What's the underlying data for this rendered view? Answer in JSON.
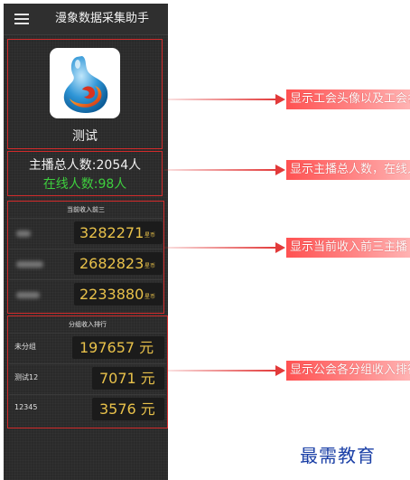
{
  "app": {
    "title": "漫象数据采集助手",
    "union_name": "测试"
  },
  "stats": {
    "total_anchors": "主播总人数:2054人",
    "online_anchors": "在线人数:98人"
  },
  "top_income": {
    "title": "当前收入前三",
    "unit": "星币",
    "rows": [
      {
        "value": "3282271"
      },
      {
        "value": "2682823"
      },
      {
        "value": "2233880"
      }
    ]
  },
  "group_income": {
    "title": "分组收入排行",
    "rows": [
      {
        "name": "未分组",
        "value": "197657 元"
      },
      {
        "name": "测试12",
        "value": "7071 元"
      },
      {
        "name": "12345",
        "value": "3576 元"
      }
    ]
  },
  "callouts": [
    "显示工会头像以及工会名称",
    "显示主播总人数，在线人数",
    "显示当前收入前三主播",
    "显示公会各分组收入排行"
  ],
  "watermark": "最需教育",
  "colors": {
    "panel_bg": "#2a2a2a",
    "outline_red": "#d22b2b",
    "online_green": "#3ecf3e",
    "value_gold": "#e8c14a",
    "callout_red": "#ff5252",
    "watermark_blue": "#1a3fa6"
  },
  "icons": {
    "menu": "hamburger-menu-icon",
    "logo": "swirl-logo-icon",
    "arrow": "right-arrow-icon"
  }
}
